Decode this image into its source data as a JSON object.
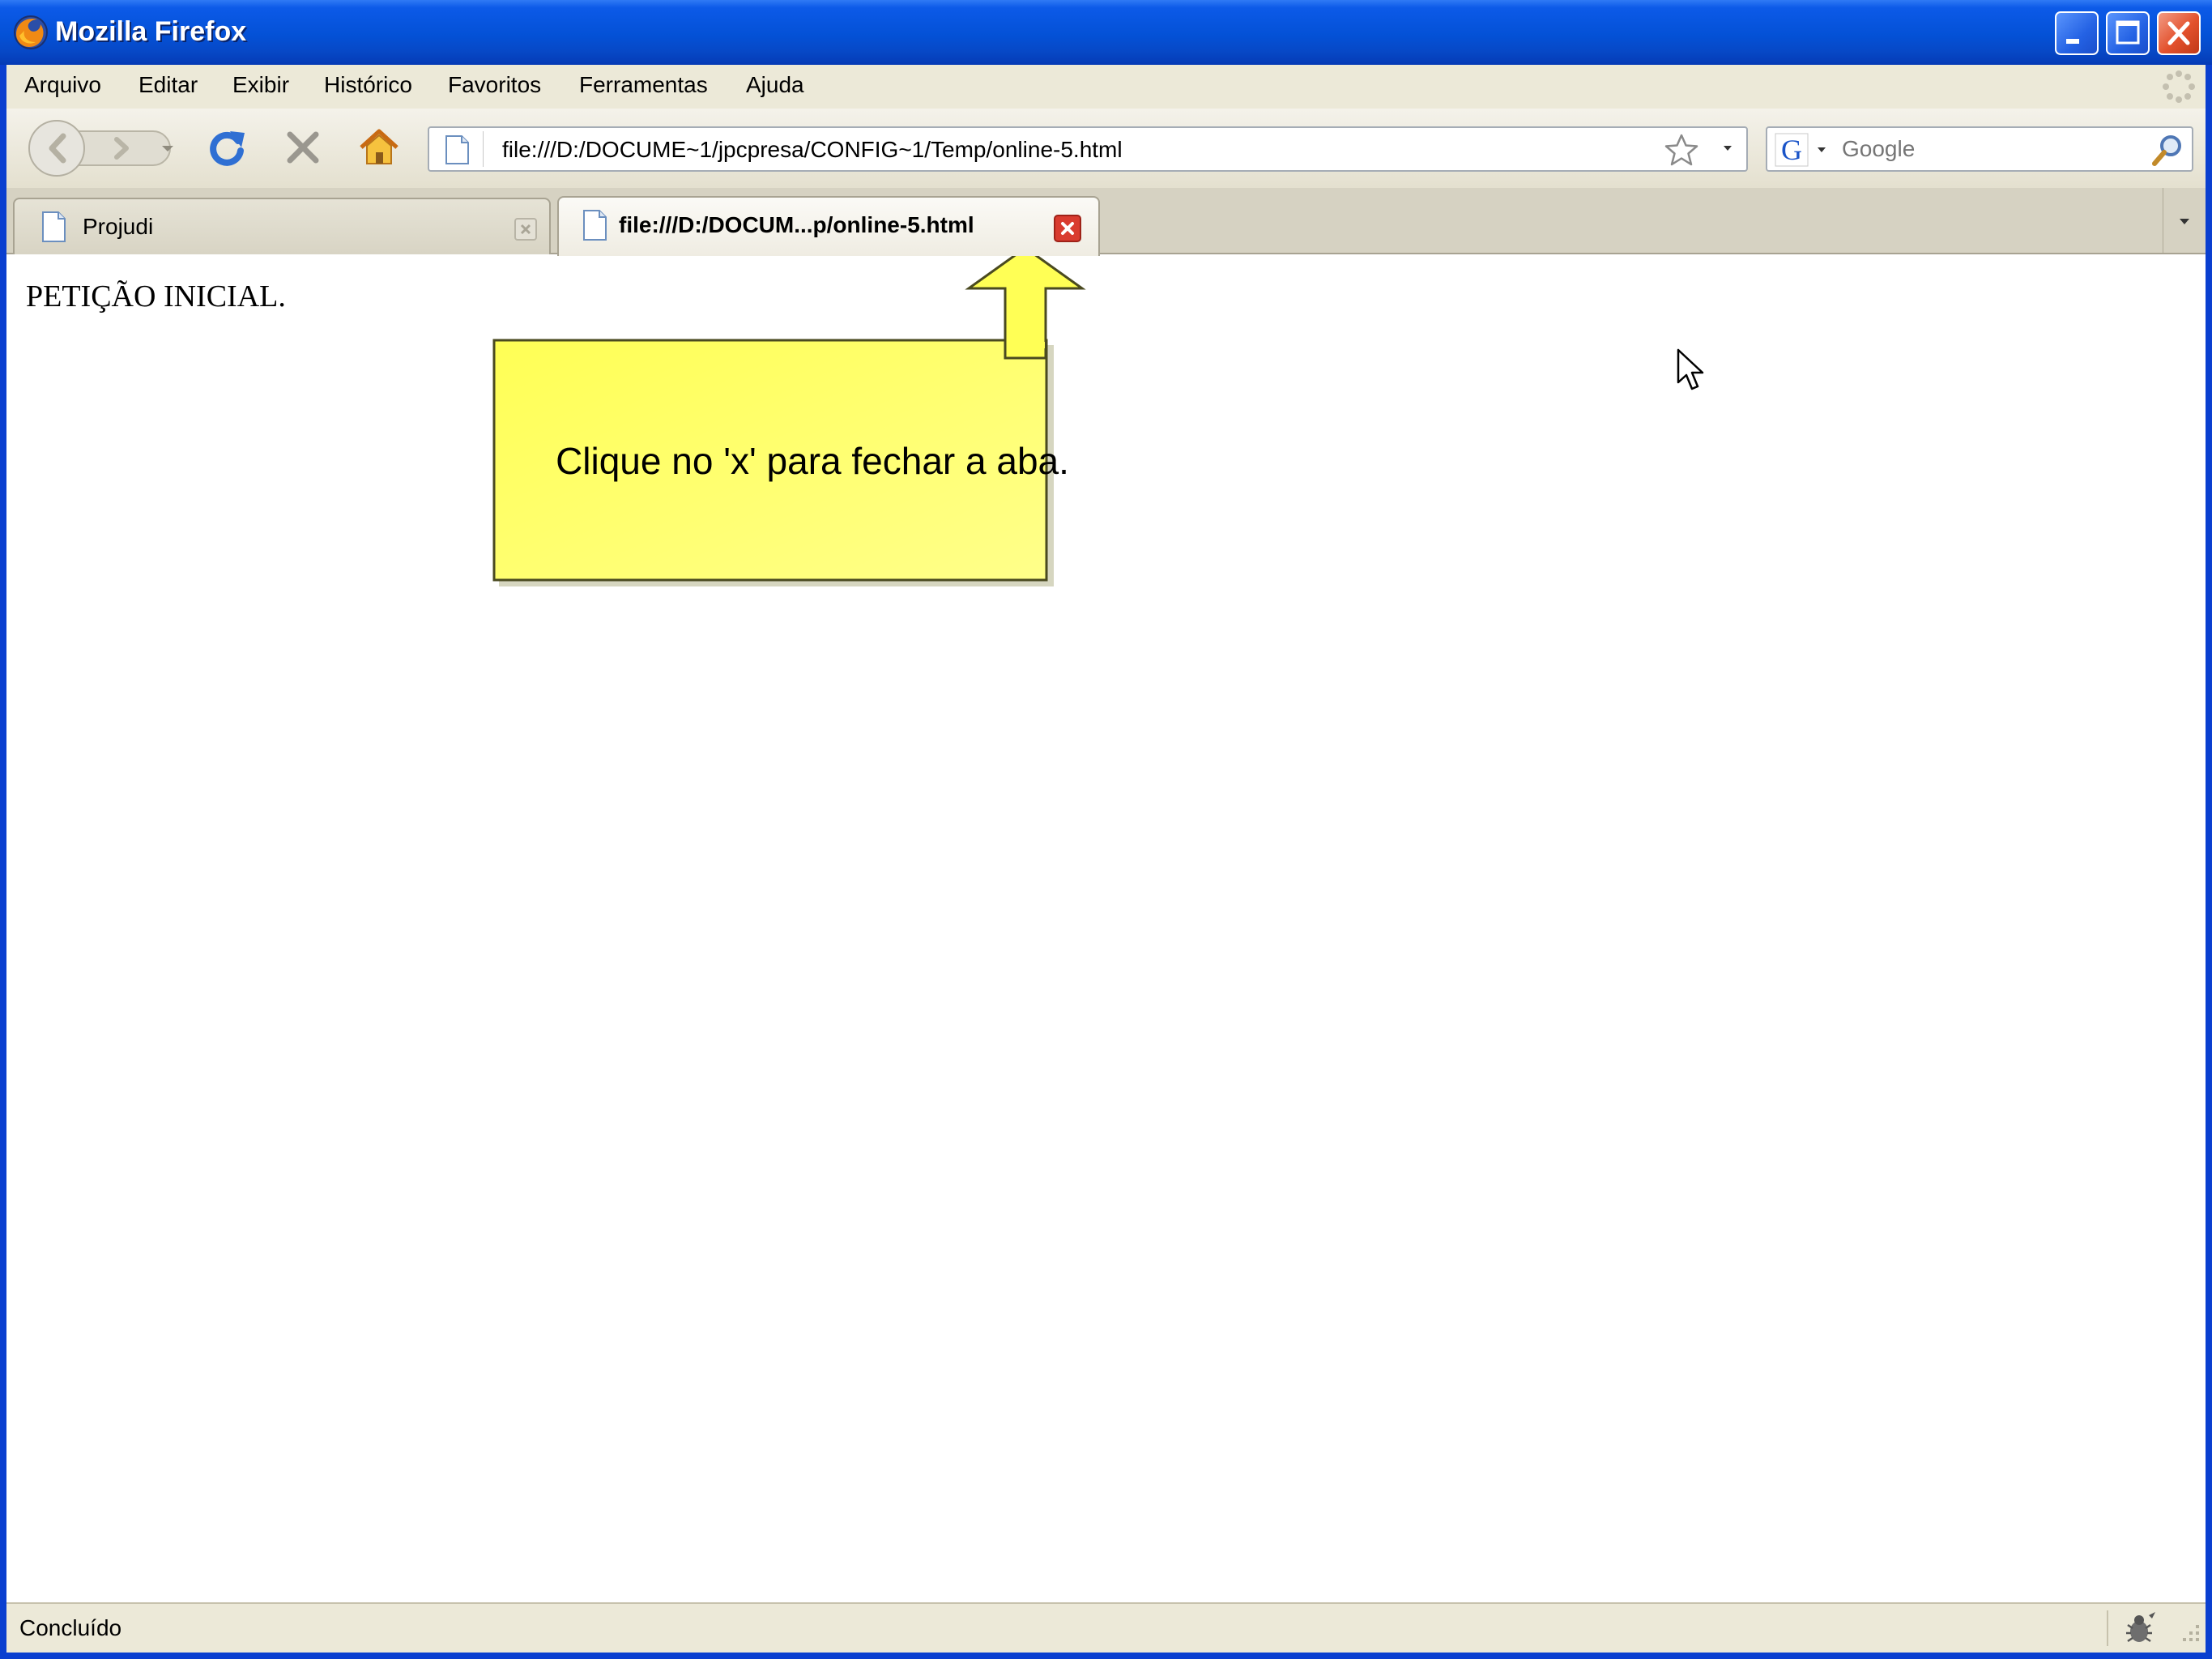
{
  "window": {
    "title": "Mozilla Firefox"
  },
  "menu": {
    "items": [
      "Arquivo",
      "Editar",
      "Exibir",
      "Histórico",
      "Favoritos",
      "Ferramentas",
      "Ajuda"
    ]
  },
  "navigation": {
    "url": "file:///D:/DOCUME~1/jpcpresa/CONFIG~1/Temp/online-5.html",
    "search_placeholder": "Google",
    "icons": [
      "back-icon",
      "forward-icon",
      "history-dropdown-icon",
      "reload-icon",
      "stop-icon",
      "home-icon",
      "page-icon",
      "bookmark-star-icon",
      "google-search-icon",
      "magnifier-icon"
    ]
  },
  "tabs": [
    {
      "label": "Projudi",
      "active": false
    },
    {
      "label": "file:///D:/DOCUM...p/online-5.html",
      "active": true
    }
  ],
  "content": {
    "heading": "PETIÇÃO INICIAL.",
    "callout_text": "Clique no 'x' para fechar a aba."
  },
  "status": {
    "text": "Concluído"
  },
  "colors": {
    "titlebar": "#0451d6",
    "chrome": "#ece9d8",
    "callout_fill": "#ffff66",
    "close_tab": "#d93b2f"
  }
}
